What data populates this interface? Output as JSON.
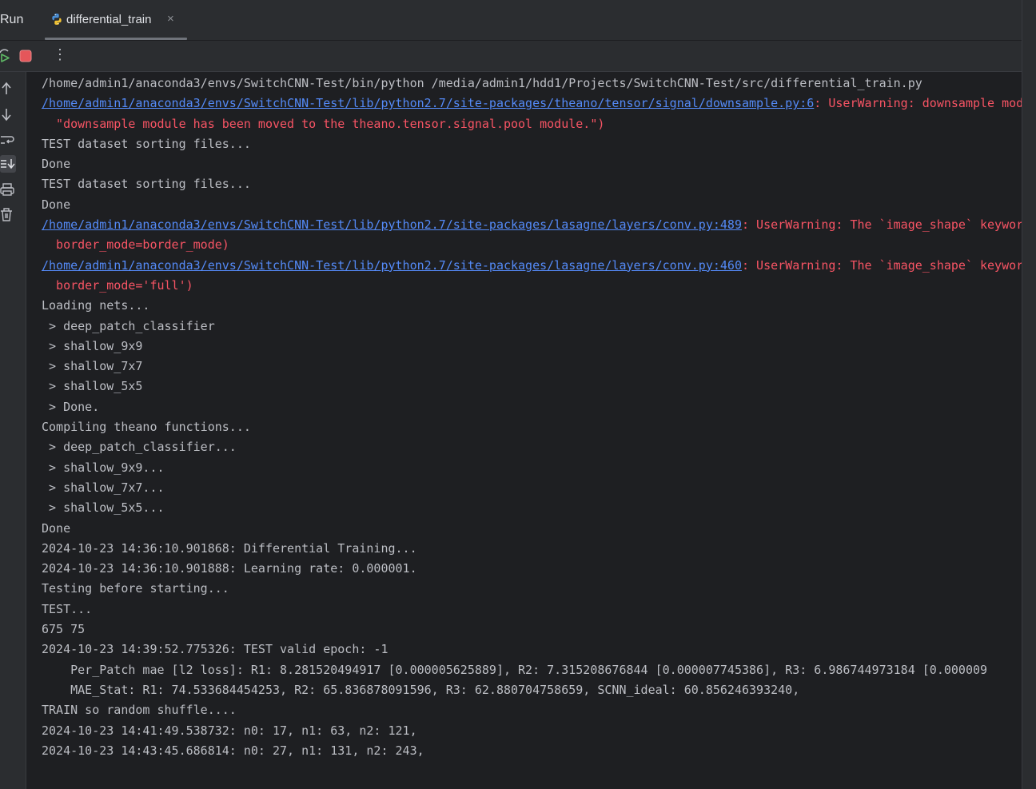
{
  "window": {
    "tool_label": "Run",
    "tab_title": "differential_train",
    "tab_close": "×"
  },
  "toolbar": {
    "more_label": "⋮"
  },
  "console": {
    "lines": [
      {
        "type": "normal",
        "text": "/home/admin1/anaconda3/envs/SwitchCNN-Test/bin/python /media/admin1/hdd1/Projects/SwitchCNN-Test/src/differential_train.py"
      },
      {
        "type": "link",
        "link": "/home/admin1/anaconda3/envs/SwitchCNN-Test/lib/python2.7/site-packages/theano/tensor/signal/downsample.py:6",
        "rest": ": UserWarning: downsample module has been moved to the theano.tensor.signal.pool module."
      },
      {
        "type": "err",
        "text": "  \"downsample module has been moved to the theano.tensor.signal.pool module.\")"
      },
      {
        "type": "normal",
        "text": "TEST dataset sorting files..."
      },
      {
        "type": "normal",
        "text": "Done"
      },
      {
        "type": "normal",
        "text": "TEST dataset sorting files..."
      },
      {
        "type": "normal",
        "text": "Done"
      },
      {
        "type": "link",
        "link": "/home/admin1/anaconda3/envs/SwitchCNN-Test/lib/python2.7/site-packages/lasagne/layers/conv.py:489",
        "rest": ": UserWarning: The `image_shape` keyword argument"
      },
      {
        "type": "err",
        "text": "  border_mode=border_mode)"
      },
      {
        "type": "link",
        "link": "/home/admin1/anaconda3/envs/SwitchCNN-Test/lib/python2.7/site-packages/lasagne/layers/conv.py:460",
        "rest": ": UserWarning: The `image_shape` keyword argument"
      },
      {
        "type": "err",
        "text": "  border_mode='full')"
      },
      {
        "type": "normal",
        "text": "Loading nets..."
      },
      {
        "type": "normal",
        "text": " > deep_patch_classifier"
      },
      {
        "type": "normal",
        "text": " > shallow_9x9"
      },
      {
        "type": "normal",
        "text": " > shallow_7x7"
      },
      {
        "type": "normal",
        "text": " > shallow_5x5"
      },
      {
        "type": "normal",
        "text": " > Done."
      },
      {
        "type": "normal",
        "text": "Compiling theano functions..."
      },
      {
        "type": "normal",
        "text": " > deep_patch_classifier..."
      },
      {
        "type": "normal",
        "text": " > shallow_9x9..."
      },
      {
        "type": "normal",
        "text": " > shallow_7x7..."
      },
      {
        "type": "normal",
        "text": " > shallow_5x5..."
      },
      {
        "type": "normal",
        "text": "Done"
      },
      {
        "type": "normal",
        "text": "2024-10-23 14:36:10.901868: Differential Training..."
      },
      {
        "type": "normal",
        "text": "2024-10-23 14:36:10.901888: Learning rate: 0.000001."
      },
      {
        "type": "normal",
        "text": "Testing before starting..."
      },
      {
        "type": "normal",
        "text": "TEST..."
      },
      {
        "type": "normal",
        "text": "675 75"
      },
      {
        "type": "normal",
        "text": "2024-10-23 14:39:52.775326: TEST valid epoch: -1"
      },
      {
        "type": "normal",
        "text": "    Per_Patch mae [l2 loss]: R1: 8.281520494917 [0.000005625889], R2: 7.315208676844 [0.000007745386], R3: 6.986744973184 [0.000009"
      },
      {
        "type": "normal",
        "text": "    MAE_Stat: R1: 74.533684454253, R2: 65.836878091596, R3: 62.880704758659, SCNN_ideal: 60.856246393240,"
      },
      {
        "type": "normal",
        "text": "TRAIN so random shuffle...."
      },
      {
        "type": "normal",
        "text": "2024-10-23 14:41:49.538732: n0: 17, n1: 63, n2: 121,"
      },
      {
        "type": "normal",
        "text": "2024-10-23 14:43:45.686814: n0: 27, n1: 131, n2: 243,"
      }
    ]
  },
  "colors": {
    "background": "#1e1f22",
    "panel": "#2b2d30",
    "text": "#bcbec4",
    "error": "#f75464",
    "link": "#548af7",
    "run_green": "#5fb865",
    "stop_red": "#e5565a"
  },
  "icons": {
    "tab": "python-icon",
    "toolbar": [
      "rerun-icon",
      "stop-icon",
      "more-options-icon"
    ],
    "gutter": [
      "scroll-up-icon",
      "scroll-down-icon",
      "soft-wrap-icon",
      "scroll-to-end-icon",
      "print-icon",
      "trash-icon"
    ]
  }
}
